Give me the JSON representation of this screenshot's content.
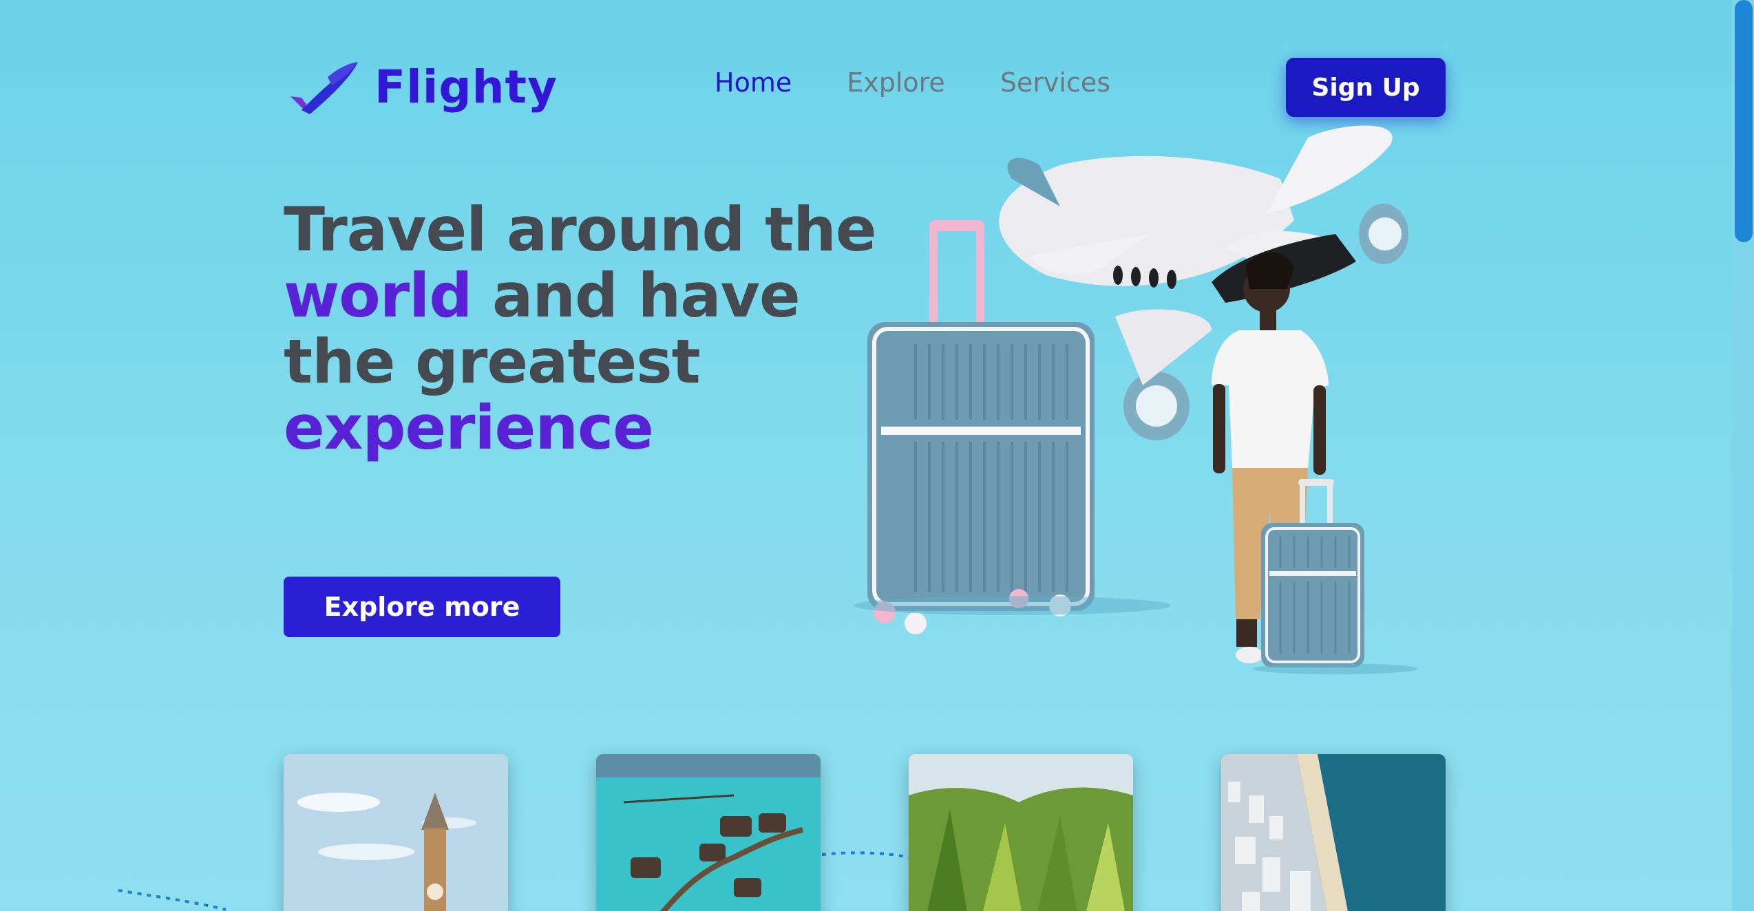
{
  "brand": {
    "name": "Flighty"
  },
  "nav": {
    "items": [
      {
        "label": "Home",
        "active": true
      },
      {
        "label": "Explore",
        "active": false
      },
      {
        "label": "Services",
        "active": false
      }
    ],
    "signup_label": "Sign Up"
  },
  "hero": {
    "line1": "Travel around the",
    "line2_highlight": "world",
    "line2_rest": " and have",
    "line3": "the greatest",
    "line4_highlight": "experience",
    "cta_label": "Explore more"
  },
  "icons": {
    "logo": "plane-checkmark-icon",
    "illustration": "traveler-with-luggage-and-plane"
  },
  "destinations": [
    {
      "scene": "big-ben-clock-tower"
    },
    {
      "scene": "overwater-bungalows"
    },
    {
      "scene": "green-mountain-ridges"
    },
    {
      "scene": "coastal-city-beach"
    }
  ],
  "colors": {
    "background": "#6bd2ea",
    "brand": "#3417d6",
    "accent": "#5a22d6",
    "button": "#2a1fd4",
    "heading": "#454a50",
    "nav_inactive": "#6c7780"
  }
}
